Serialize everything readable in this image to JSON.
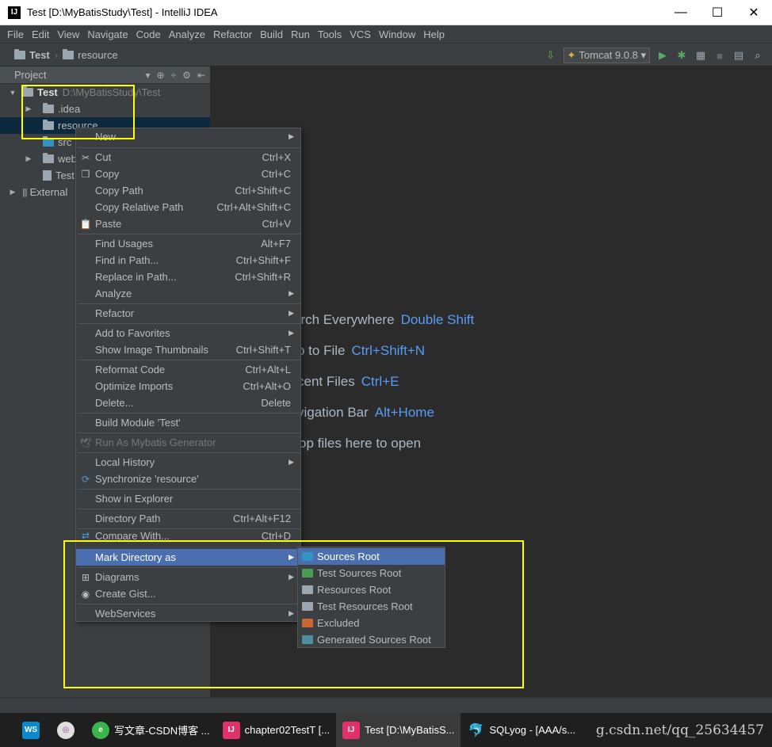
{
  "window": {
    "title": "Test [D:\\MyBatisStudy\\Test] - IntelliJ IDEA",
    "minimize": "—",
    "maximize": "☐",
    "close": "✕"
  },
  "menubar": [
    "File",
    "Edit",
    "View",
    "Navigate",
    "Code",
    "Analyze",
    "Refactor",
    "Build",
    "Run",
    "Tools",
    "VCS",
    "Window",
    "Help"
  ],
  "breadcrumb": {
    "project": "Test",
    "folder": "resource"
  },
  "toolbar": {
    "run_config": "Tomcat 9.0.8 ▾"
  },
  "project_panel": {
    "header": "Project",
    "root_name": "Test",
    "root_path": "D:\\MyBatisStudy\\Test",
    "items": [
      ".idea",
      "resource",
      "src",
      "web",
      "Test.",
      "External"
    ]
  },
  "editor_hints": [
    {
      "text": "arch Everywhere",
      "key": "Double Shift"
    },
    {
      "text": "o to File",
      "key": "Ctrl+Shift+N"
    },
    {
      "text": "cent Files",
      "key": "Ctrl+E"
    },
    {
      "text": "vigation Bar",
      "key": "Alt+Home"
    },
    {
      "text": "op files here to open",
      "key": ""
    }
  ],
  "context_menu": {
    "new": "New",
    "cut": "Cut",
    "cut_sc": "Ctrl+X",
    "copy": "Copy",
    "copy_sc": "Ctrl+C",
    "copy_path": "Copy Path",
    "copy_path_sc": "Ctrl+Shift+C",
    "copy_rel": "Copy Relative Path",
    "copy_rel_sc": "Ctrl+Alt+Shift+C",
    "paste": "Paste",
    "paste_sc": "Ctrl+V",
    "find_usages": "Find Usages",
    "find_usages_sc": "Alt+F7",
    "find_in_path": "Find in Path...",
    "find_in_path_sc": "Ctrl+Shift+F",
    "replace_in_path": "Replace in Path...",
    "replace_in_path_sc": "Ctrl+Shift+R",
    "analyze": "Analyze",
    "refactor": "Refactor",
    "add_fav": "Add to Favorites",
    "thumbs": "Show Image Thumbnails",
    "thumbs_sc": "Ctrl+Shift+T",
    "reformat": "Reformat Code",
    "reformat_sc": "Ctrl+Alt+L",
    "optimize": "Optimize Imports",
    "optimize_sc": "Ctrl+Alt+O",
    "delete": "Delete...",
    "delete_sc": "Delete",
    "build_module": "Build Module 'Test'",
    "mybatis": "Run As Mybatis Generator",
    "local_history": "Local History",
    "sync": "Synchronize 'resource'",
    "explorer": "Show in Explorer",
    "dir_path": "Directory Path",
    "dir_path_sc": "Ctrl+Alt+F12",
    "compare": "Compare With...",
    "compare_sc": "Ctrl+D",
    "mark_dir": "Mark Directory as",
    "diagrams": "Diagrams",
    "gist": "Create Gist...",
    "webservices": "WebServices"
  },
  "submenu": [
    {
      "label": "Sources Root",
      "color": "#3592c4"
    },
    {
      "label": "Test Sources Root",
      "color": "#499c54"
    },
    {
      "label": "Resources Root",
      "color": "#9aa7b0"
    },
    {
      "label": "Test Resources Root",
      "color": "#9aa7b0"
    },
    {
      "label": "Excluded",
      "color": "#cc6633"
    },
    {
      "label": "Generated Sources Root",
      "color": "#4f8ea0"
    }
  ],
  "taskbar": {
    "items": [
      "写文章-CSDN博客 ...",
      "chapter02TestT [...",
      "Test [D:\\MyBatisS...",
      "SQLyog - [AAA/s..."
    ],
    "watermark": "g.csdn.net/qq_25634457"
  },
  "colors": {
    "highlight": "#4b6eaf",
    "annotation": "#ffff00",
    "shortcut_blue": "#589df6"
  }
}
